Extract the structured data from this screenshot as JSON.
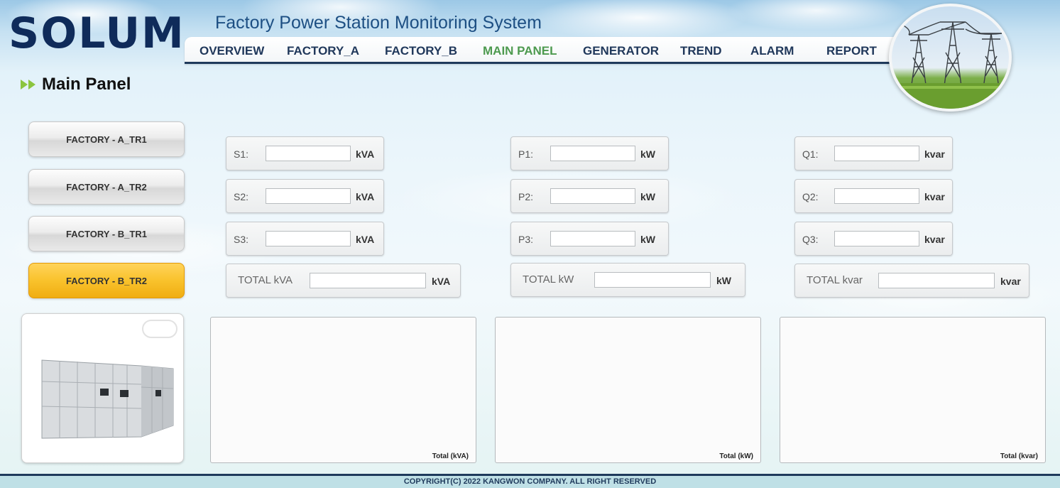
{
  "header": {
    "logo": "SOLUM",
    "title": "Factory Power Station Monitoring System"
  },
  "nav": {
    "items": [
      {
        "label": "OVERVIEW"
      },
      {
        "label": "FACTORY_A"
      },
      {
        "label": "FACTORY_B"
      },
      {
        "label": "MAIN PANEL"
      },
      {
        "label": "GENERATOR"
      },
      {
        "label": "TREND"
      },
      {
        "label": "ALARM"
      },
      {
        "label": "REPORT"
      }
    ],
    "active": "MAIN PANEL",
    "active_color": "#4d9a4f"
  },
  "page": {
    "title": "Main Panel"
  },
  "sidebar": {
    "buttons": [
      {
        "label": "FACTORY - A_TR1"
      },
      {
        "label": "FACTORY - A_TR2"
      },
      {
        "label": "FACTORY - B_TR1"
      },
      {
        "label": "FACTORY - B_TR2"
      }
    ],
    "active": "FACTORY - B_TR2",
    "active_color": "#f9c22c"
  },
  "fields": {
    "s": {
      "rows": [
        {
          "label": "S1:",
          "value": "",
          "unit": "kVA"
        },
        {
          "label": "S2:",
          "value": "",
          "unit": "kVA"
        },
        {
          "label": "S3:",
          "value": "",
          "unit": "kVA"
        }
      ],
      "total": {
        "label": "TOTAL kVA",
        "value": "",
        "unit": "kVA"
      }
    },
    "p": {
      "rows": [
        {
          "label": "P1:",
          "value": "",
          "unit": "kW"
        },
        {
          "label": "P2:",
          "value": "",
          "unit": "kW"
        },
        {
          "label": "P3:",
          "value": "",
          "unit": "kW"
        }
      ],
      "total": {
        "label": "TOTAL kW",
        "value": "",
        "unit": "kW"
      }
    },
    "q": {
      "rows": [
        {
          "label": "Q1:",
          "value": "",
          "unit": "kvar"
        },
        {
          "label": "Q2:",
          "value": "",
          "unit": "kvar"
        },
        {
          "label": "Q3:",
          "value": "",
          "unit": "kvar"
        }
      ],
      "total": {
        "label": "TOTAL kvar",
        "value": "",
        "unit": "kvar"
      }
    }
  },
  "charts": [
    {
      "caption": "Total (kVA)"
    },
    {
      "caption": "Total (kW)"
    },
    {
      "caption": "Total (kvar)"
    }
  ],
  "footer": {
    "copyright": "COPYRIGHT(C) 2022 KANGWON COMPANY. ALL RIGHT RESERVED"
  }
}
